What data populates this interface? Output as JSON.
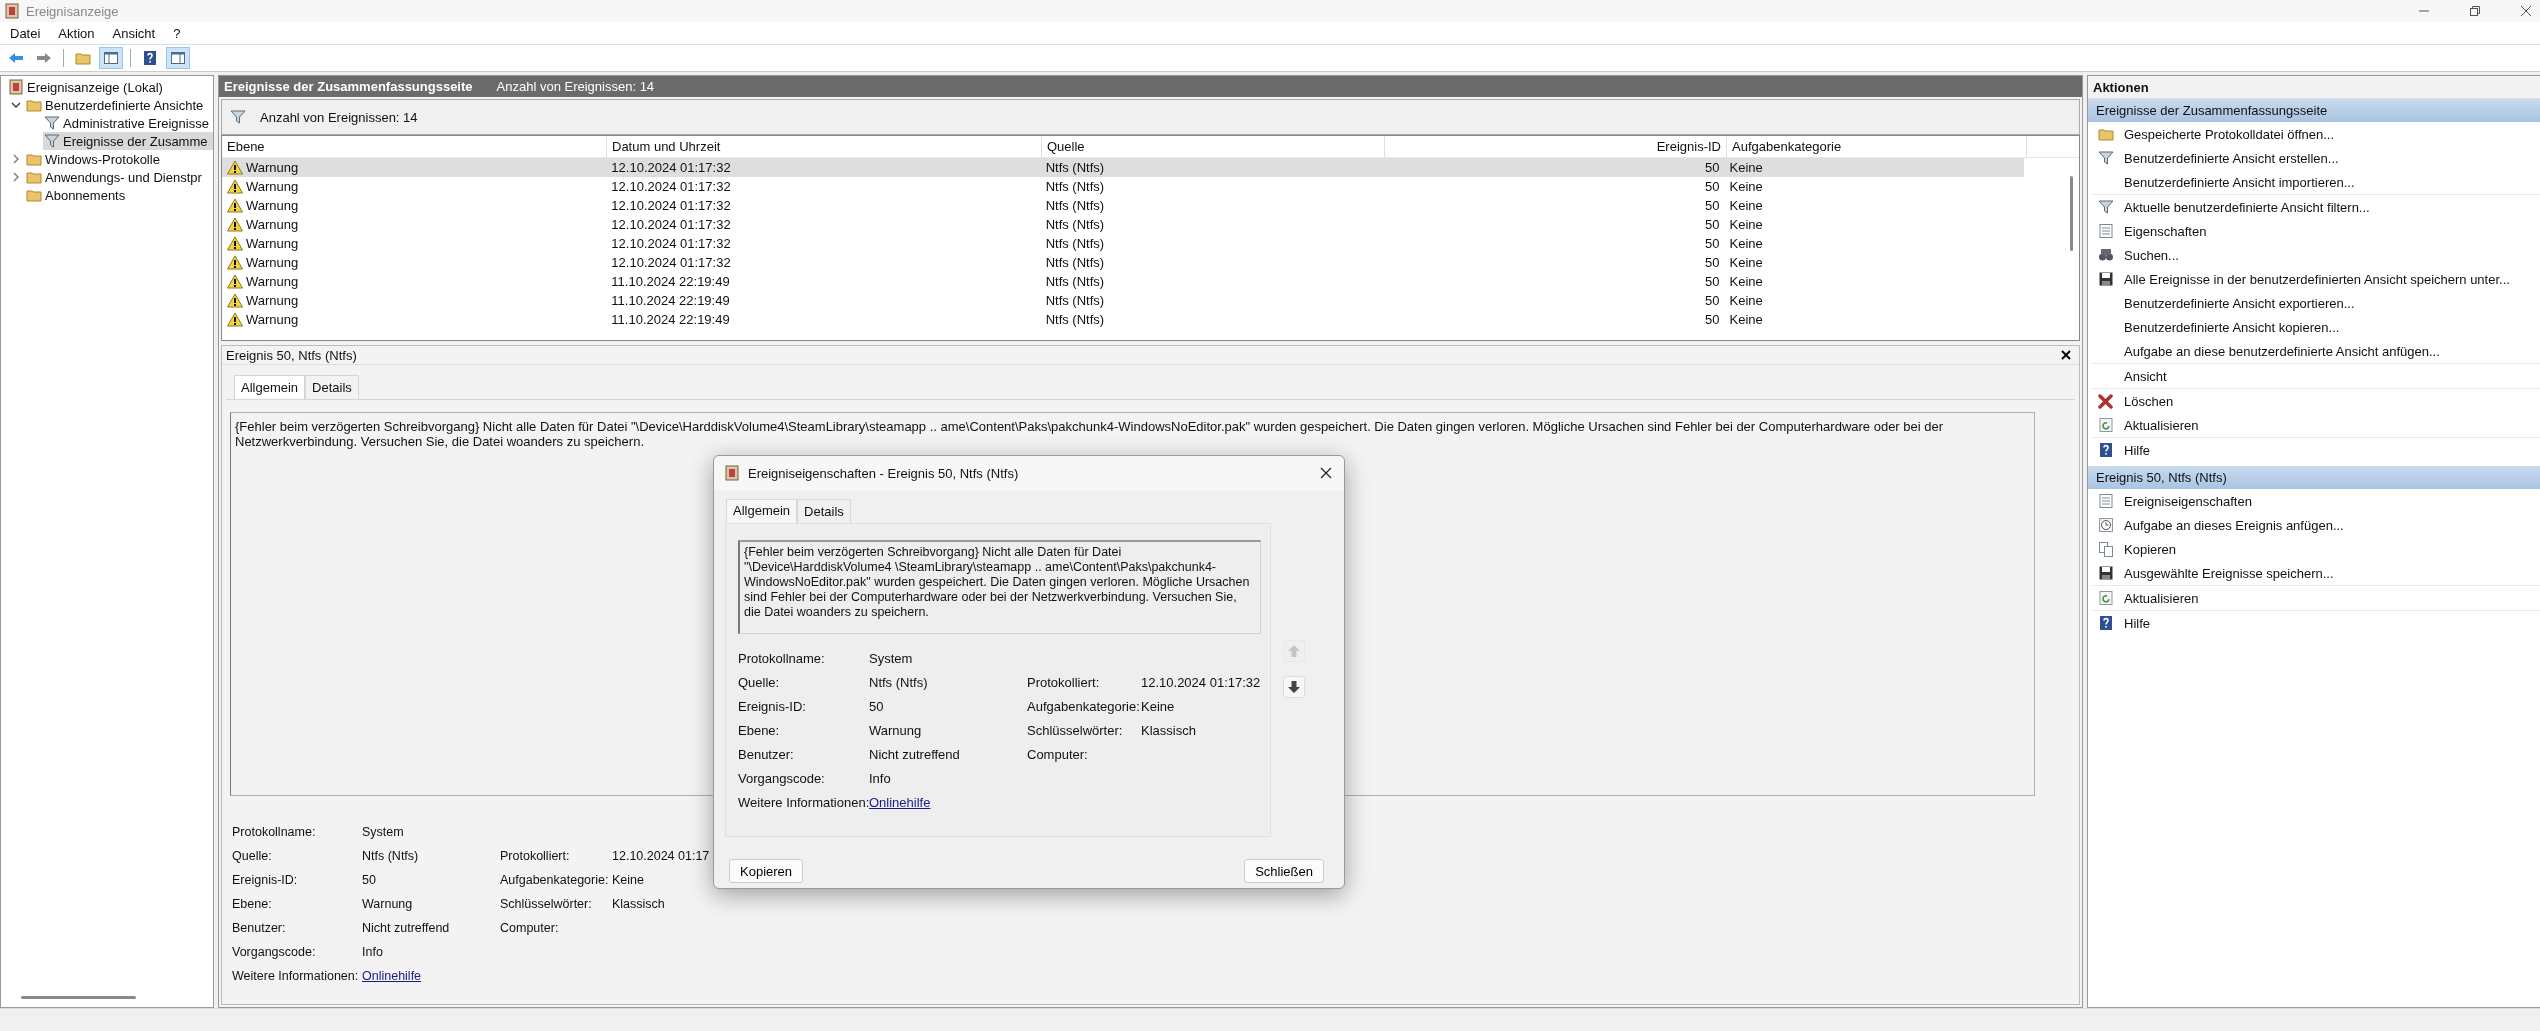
{
  "window": {
    "title": "Ereignisanzeige"
  },
  "menu": [
    "Datei",
    "Aktion",
    "Ansicht",
    "?"
  ],
  "toolbar": [
    [
      {
        "kind": "back",
        "on": false
      },
      {
        "kind": "forward",
        "on": false
      }
    ],
    [
      {
        "kind": "folder",
        "on": false
      },
      {
        "kind": "treepane",
        "on": true
      }
    ],
    [
      {
        "kind": "help",
        "on": false
      },
      {
        "kind": "actionpane",
        "on": true
      }
    ]
  ],
  "tree": [
    {
      "label": "Ereignisanzeige (Lokal)",
      "kind": "viewer",
      "selected": false,
      "children": [
        {
          "label": "Benutzerdefinierte Ansichte",
          "kind": "folder",
          "selected": false,
          "expanded": true,
          "children": [
            {
              "label": "Administrative Ereignisse",
              "kind": "filter",
              "selected": false
            },
            {
              "label": "Ereignisse der Zusamme",
              "kind": "filter",
              "selected": true
            }
          ]
        },
        {
          "label": "Windows-Protokolle",
          "kind": "folder",
          "selected": false,
          "expanded": false
        },
        {
          "label": "Anwendungs- und Dienstpr",
          "kind": "folder",
          "selected": false,
          "expanded": false
        },
        {
          "label": "Abonnements",
          "kind": "folder",
          "selected": false
        }
      ]
    }
  ],
  "summary_header": {
    "title": "Ereignisse der Zusammenfassungsseite",
    "count": "Anzahl von Ereignissen: 14"
  },
  "filter_bar": {
    "text": "Anzahl von Ereignissen: 14"
  },
  "table": {
    "columns": [
      "Ebene",
      "Datum und Uhrzeit",
      "Quelle",
      "Ereignis-ID",
      "Aufgabenkategorie"
    ],
    "rows": [
      {
        "level": "Warnung",
        "date": "12.10.2024 01:17:32",
        "source": "Ntfs (Ntfs)",
        "id": "50",
        "category": "Keine",
        "selected": true
      },
      {
        "level": "Warnung",
        "date": "12.10.2024 01:17:32",
        "source": "Ntfs (Ntfs)",
        "id": "50",
        "category": "Keine",
        "selected": false
      },
      {
        "level": "Warnung",
        "date": "12.10.2024 01:17:32",
        "source": "Ntfs (Ntfs)",
        "id": "50",
        "category": "Keine",
        "selected": false
      },
      {
        "level": "Warnung",
        "date": "12.10.2024 01:17:32",
        "source": "Ntfs (Ntfs)",
        "id": "50",
        "category": "Keine",
        "selected": false
      },
      {
        "level": "Warnung",
        "date": "12.10.2024 01:17:32",
        "source": "Ntfs (Ntfs)",
        "id": "50",
        "category": "Keine",
        "selected": false
      },
      {
        "level": "Warnung",
        "date": "12.10.2024 01:17:32",
        "source": "Ntfs (Ntfs)",
        "id": "50",
        "category": "Keine",
        "selected": false
      },
      {
        "level": "Warnung",
        "date": "11.10.2024 22:19:49",
        "source": "Ntfs (Ntfs)",
        "id": "50",
        "category": "Keine",
        "selected": false
      },
      {
        "level": "Warnung",
        "date": "11.10.2024 22:19:49",
        "source": "Ntfs (Ntfs)",
        "id": "50",
        "category": "Keine",
        "selected": false
      },
      {
        "level": "Warnung",
        "date": "11.10.2024 22:19:49",
        "source": "Ntfs (Ntfs)",
        "id": "50",
        "category": "Keine",
        "selected": false
      }
    ]
  },
  "detail": {
    "title": "Ereignis 50, Ntfs (Ntfs)",
    "tabs": [
      {
        "label": "Allgemein",
        "selected": true
      },
      {
        "label": "Details",
        "selected": false
      }
    ],
    "message": "{Fehler beim verzögerten Schreibvorgang} Nicht alle Daten für Datei \"\\Device\\HarddiskVolume4\\SteamLibrary\\steamapp .. ame\\Content\\Paks\\pakchunk4-WindowsNoEditor.pak\" wurden gespeichert. Die Daten gingen verloren. Mögliche Ursachen sind Fehler bei der Computerhardware oder bei der Netzwerkverbindung. Versuchen Sie, die Datei woanders zu speichern.",
    "fields": [
      {
        "label": "Protokollname:",
        "value": "System",
        "kind": "text"
      },
      {
        "label": "Quelle:",
        "value": "Ntfs (Ntfs)",
        "kind": "text"
      },
      {
        "label": "Ereignis-ID:",
        "value": "50",
        "kind": "text"
      },
      {
        "label": "Ebene:",
        "value": "Warnung",
        "kind": "text"
      },
      {
        "label": "Benutzer:",
        "value": "Nicht zutreffend",
        "kind": "text"
      },
      {
        "label": "Vorgangscode:",
        "value": "Info",
        "kind": "text"
      },
      {
        "label": "Weitere Informationen:",
        "value": "Onlinehilfe",
        "kind": "link"
      }
    ],
    "fields_right": [
      {
        "label": "Protokolliert:",
        "value": "12.10.2024 01:17"
      },
      {
        "label": "Aufgabenkategorie:",
        "value": "Keine"
      },
      {
        "label": "Schlüsselwörter:",
        "value": "Klassisch"
      },
      {
        "label": "Computer:"
      }
    ]
  },
  "dialog": {
    "title": "Ereigniseigenschaften - Ereignis 50, Ntfs (Ntfs)",
    "tabs": [
      {
        "label": "Allgemein",
        "selected": true
      },
      {
        "label": "Details",
        "selected": false
      }
    ],
    "message": "{Fehler beim verzögerten Schreibvorgang} Nicht alle Daten für Datei \"\\Device\\HarddiskVolume4 \\SteamLibrary\\steamapp .. ame\\Content\\Paks\\pakchunk4-WindowsNoEditor.pak\" wurden gespeichert. Die Daten gingen verloren. Mögliche Ursachen sind Fehler bei der Computerhardware oder bei der Netzwerkverbindung. Versuchen Sie, die Datei woanders zu speichern.",
    "fields": [
      {
        "label": "Protokollname:",
        "value": "System",
        "kind": "text"
      },
      {
        "label": "Quelle:",
        "value": "Ntfs (Ntfs)",
        "kind": "text"
      },
      {
        "label": "Ereignis-ID:",
        "value": "50",
        "kind": "text"
      },
      {
        "label": "Ebene:",
        "value": "Warnung",
        "kind": "text"
      },
      {
        "label": "Benutzer:",
        "value": "Nicht zutreffend",
        "kind": "text"
      },
      {
        "label": "Vorgangscode:",
        "value": "Info",
        "kind": "text"
      },
      {
        "label": "Weitere Informationen:",
        "value": "Onlinehilfe",
        "kind": "link"
      }
    ],
    "fields_right": [
      {
        "label": "Protokolliert:",
        "value": "12.10.2024 01:17:32"
      },
      {
        "label": "Aufgabenkategorie:",
        "value": "Keine"
      },
      {
        "label": "Schlüsselwörter:",
        "value": "Klassisch"
      },
      {
        "label": "Computer:"
      }
    ],
    "nav": [
      {
        "kind": "up",
        "disabled": true
      },
      {
        "kind": "down",
        "disabled": false
      }
    ],
    "buttons": [
      "Kopieren",
      "Schließen"
    ]
  },
  "actions": {
    "title": "Aktionen",
    "sections": [
      {
        "title": "Ereignisse der Zusammenfassungsseite",
        "groups": [
          [
            {
              "label": "Gespeicherte Protokolldatei öffnen...",
              "kind": "open"
            },
            {
              "label": "Benutzerdefinierte Ansicht erstellen...",
              "kind": "filter"
            },
            {
              "label": "Benutzerdefinierte Ansicht importieren...",
              "kind": "plain"
            }
          ],
          [
            {
              "label": "Aktuelle benutzerdefinierte Ansicht filtern...",
              "kind": "filter"
            },
            {
              "label": "Eigenschaften",
              "kind": "properties"
            },
            {
              "label": "Suchen...",
              "kind": "find"
            },
            {
              "label": "Alle Ereignisse in der benutzerdefinierten Ansicht speichern unter...",
              "kind": "save"
            },
            {
              "label": "Benutzerdefinierte Ansicht exportieren...",
              "kind": "plain"
            },
            {
              "label": "Benutzerdefinierte Ansicht kopieren...",
              "kind": "plain"
            },
            {
              "label": "Aufgabe an diese benutzerdefinierte Ansicht anfügen...",
              "kind": "plain"
            }
          ],
          [
            {
              "label": "Ansicht",
              "kind": "plain"
            }
          ],
          [
            {
              "label": "Löschen",
              "kind": "delete"
            },
            {
              "label": "Aktualisieren",
              "kind": "refresh"
            }
          ],
          [
            {
              "label": "Hilfe",
              "kind": "help"
            }
          ]
        ]
      },
      {
        "title": "Ereignis 50, Ntfs (Ntfs)",
        "groups": [
          [
            {
              "label": "Ereigniseigenschaften",
              "kind": "properties"
            },
            {
              "label": "Aufgabe an dieses Ereignis anfügen...",
              "kind": "task"
            },
            {
              "label": "Kopieren",
              "kind": "copy"
            },
            {
              "label": "Ausgewählte Ereignisse speichern...",
              "kind": "save"
            }
          ],
          [
            {
              "label": "Aktualisieren",
              "kind": "refresh"
            }
          ],
          [
            {
              "label": "Hilfe",
              "kind": "help"
            }
          ]
        ]
      }
    ]
  }
}
